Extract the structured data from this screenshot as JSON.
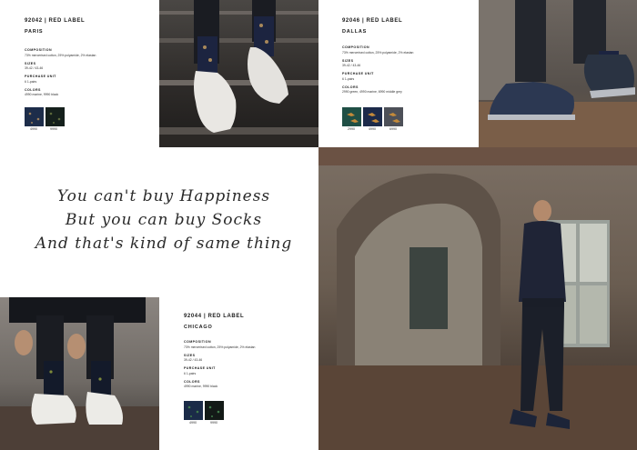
{
  "paris": {
    "code": "92042 | RED LABEL",
    "city": "PARIS",
    "composition_label": "COMPOSITION",
    "composition": "73% mercerised cotton, 25% polyamide, 2% elastan",
    "sizes_label": "SIZES",
    "sizes": "39-42 / 43-46",
    "unit_label": "PURCHASE UNIT",
    "unit": "6 1-pairs",
    "colors_label": "COLORS",
    "colors": "4990 marine, 9990 black",
    "swatches": [
      {
        "num": "4990",
        "color": "#1d2d4a"
      },
      {
        "num": "9990",
        "color": "#15201c"
      }
    ]
  },
  "dallas": {
    "code": "92046 | RED LABEL",
    "city": "DALLAS",
    "composition_label": "COMPOSITION",
    "composition": "73% mercerised cotton, 25% polyamide, 2% elastan",
    "sizes_label": "SIZES",
    "sizes": "39-42 / 43-46",
    "unit_label": "PURCHASE UNIT",
    "unit": "6 1-pairs",
    "colors_label": "COLORS",
    "colors": "2990 green, 4990 marine, 6990 middle grey",
    "swatches": [
      {
        "num": "2990",
        "color": "#1f4f45"
      },
      {
        "num": "4990",
        "color": "#1c2a4a"
      },
      {
        "num": "6990",
        "color": "#4d5058"
      }
    ]
  },
  "chicago": {
    "code": "92044 | RED LABEL",
    "city": "CHICAGO",
    "composition_label": "COMPOSITION",
    "composition": "73% mercerised cotton, 25% polyamide, 2% elastan",
    "sizes_label": "SIZES",
    "sizes": "39-42 / 43-46",
    "unit_label": "PURCHASE UNIT",
    "unit": "6 1-pairs",
    "colors_label": "COLORS",
    "colors": "4990 marine, 9990 black",
    "swatches": [
      {
        "num": "4990",
        "color": "#1b2b48"
      },
      {
        "num": "9990",
        "color": "#131a17"
      }
    ]
  },
  "quote": {
    "line1": "You can't buy Happiness",
    "line2": "But you can buy Socks",
    "line3": "And that's kind of same thing"
  }
}
